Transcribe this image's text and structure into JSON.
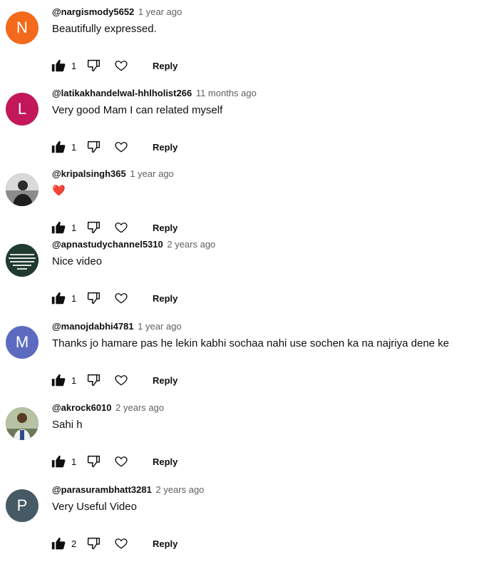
{
  "comments": [
    {
      "handle": "@nargismody5652",
      "time": "1 year ago",
      "text": "Beautifully expressed.",
      "likes": "1",
      "avatar_letter": "N",
      "avatar_color": "#f46a1c"
    },
    {
      "handle": "@latikakhandelwal-hhlholist266",
      "time": "11 months ago",
      "text": "Very good Mam  I can related myself",
      "likes": "1",
      "avatar_letter": "L",
      "avatar_color": "#c2185b"
    },
    {
      "handle": "@kripalsingh365",
      "time": "1 year ago",
      "text": "❤️",
      "likes": "1",
      "avatar_letter": "",
      "avatar_color": "#3a3a3a"
    },
    {
      "handle": "@apnastudychannel5310",
      "time": "2 years ago",
      "text": "Nice video",
      "likes": "1",
      "avatar_letter": "",
      "avatar_color": "#1f3b2f"
    },
    {
      "handle": "@manojdabhi4781",
      "time": "1 year ago",
      "text": "Thanks jo hamare pas he lekin kabhi sochaa nahi use sochen ka na najriya dene ke",
      "likes": "1",
      "avatar_letter": "M",
      "avatar_color": "#5c6bc0"
    },
    {
      "handle": "@akrock6010",
      "time": "2 years ago",
      "text": "Sahi h",
      "likes": "1",
      "avatar_letter": "",
      "avatar_color": "#7a8a6a"
    },
    {
      "handle": "@parasurambhatt3281",
      "time": "2 years ago",
      "text": "Very Useful  Video",
      "likes": "2",
      "avatar_letter": "P",
      "avatar_color": "#455a64"
    }
  ],
  "labels": {
    "reply": "Reply"
  },
  "icons": {
    "like": "thumbs-up-icon",
    "dislike": "thumbs-down-icon",
    "heart": "heart-icon"
  }
}
